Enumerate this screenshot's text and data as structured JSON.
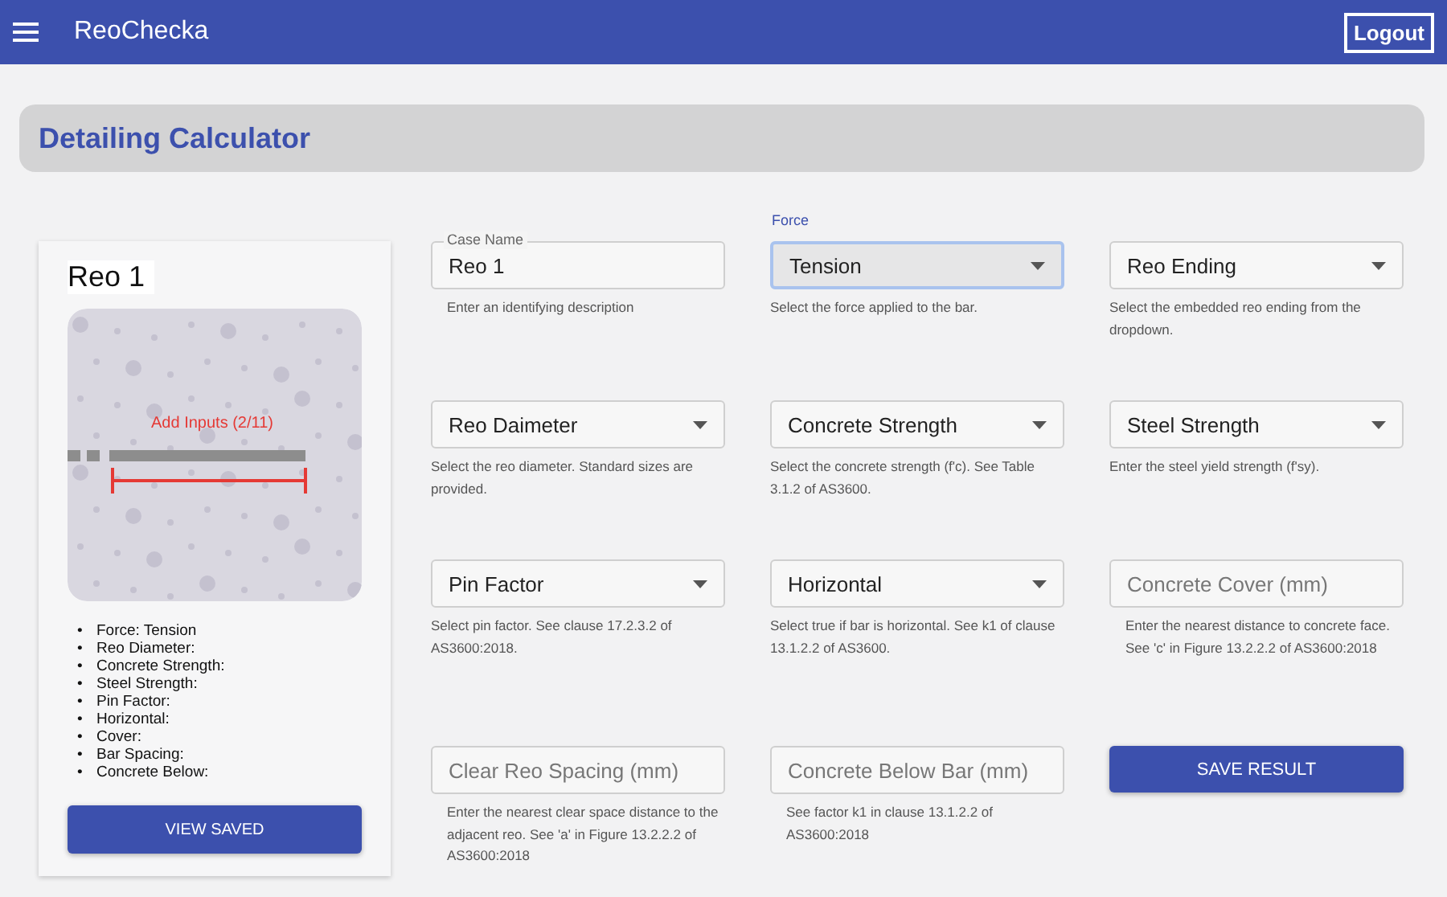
{
  "app_bar": {
    "title": "ReoChecka",
    "logout": "Logout"
  },
  "page_title": "Detailing Calculator",
  "summary_card": {
    "title": "Reo 1",
    "diagram_label": "Add Inputs (2/11)",
    "items": [
      {
        "bullet": "•",
        "text": "Force: Tension"
      },
      {
        "bullet": "•",
        "text": "Reo Diameter:"
      },
      {
        "bullet": "•",
        "text": "Concrete Strength:"
      },
      {
        "bullet": "•",
        "text": "Steel Strength:"
      },
      {
        "bullet": "•",
        "text": "Pin Factor:"
      },
      {
        "bullet": "•",
        "text": "Horizontal:"
      },
      {
        "bullet": "•",
        "text": "Cover:"
      },
      {
        "bullet": "•",
        "text": "Bar Spacing:"
      },
      {
        "bullet": "•",
        "text": "Concrete Below:"
      }
    ],
    "button": "VIEW SAVED"
  },
  "fields": [
    {
      "kind": "text",
      "label": "Case Name",
      "value": "Reo 1",
      "helper": "Enter an identifying description"
    },
    {
      "kind": "select",
      "label": "Force",
      "value": "Tension",
      "focused": true,
      "helper": "Select the force applied to the bar."
    },
    {
      "kind": "select",
      "value": "Reo Ending",
      "focused": false,
      "helper": "Select the embedded reo ending from the dropdown."
    },
    {
      "kind": "select",
      "value": "Reo Daimeter",
      "focused": false,
      "helper": "Select the reo diameter. Standard sizes are provided."
    },
    {
      "kind": "select",
      "value": "Concrete Strength",
      "focused": false,
      "helper": "Select the concrete strength (f'c). See Table 3.1.2 of AS3600."
    },
    {
      "kind": "select",
      "value": "Steel Strength",
      "focused": false,
      "helper": "Enter the steel yield strength (f'sy)."
    },
    {
      "kind": "select",
      "value": "Pin Factor",
      "focused": false,
      "helper": "Select pin factor. See clause 17.2.3.2 of AS3600:2018."
    },
    {
      "kind": "select",
      "value": "Horizontal",
      "focused": false,
      "helper": "Select true if bar is horizontal. See k1 of clause 13.1.2.2 of AS3600."
    },
    {
      "kind": "input",
      "placeholder": "Concrete Cover (mm)",
      "helper": "Enter the nearest distance to concrete face. See 'c' in Figure 13.2.2.2 of AS3600:2018"
    },
    {
      "kind": "input",
      "placeholder": "Clear Reo Spacing (mm)",
      "helper": "Enter the nearest clear space distance to the adjacent reo. See 'a' in Figure 13.2.2.2 of AS3600:2018"
    },
    {
      "kind": "input",
      "placeholder": "Concrete Below Bar (mm)",
      "helper": "See factor k1 in clause 13.1.2.2 of AS3600:2018"
    },
    {
      "kind": "button",
      "label": "SAVE RESULT"
    }
  ]
}
